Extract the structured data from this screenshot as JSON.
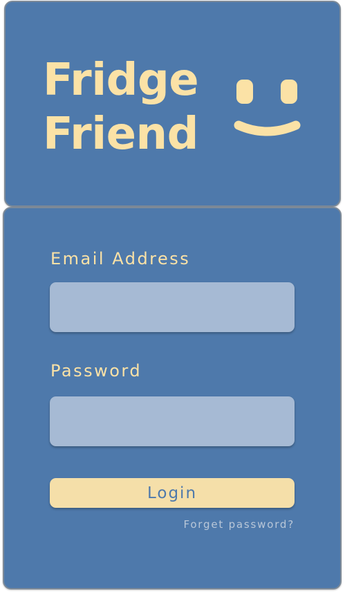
{
  "app": {
    "title_line1": "Fridge",
    "title_line2": "Friend",
    "logo_icon": "smiley-face-icon"
  },
  "login": {
    "email_label": "Email Address",
    "email_value": "",
    "password_label": "Password",
    "password_value": "",
    "login_button_label": "Login",
    "forget_password_label": "Forget password?"
  },
  "colors": {
    "card_background": "#4e79ab",
    "accent_yellow": "#fbe2a6",
    "input_background": "#a6bad4",
    "button_background": "#f5dfa9",
    "link_color": "#b9c7d8"
  }
}
